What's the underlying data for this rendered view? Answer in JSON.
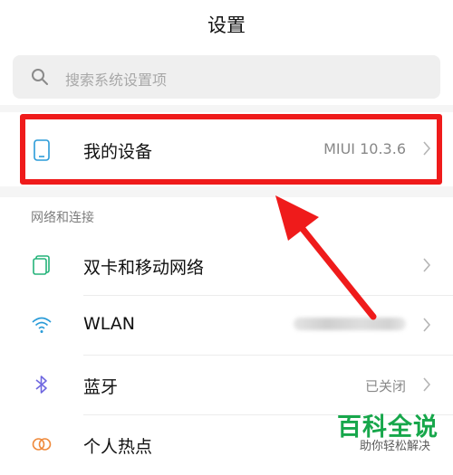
{
  "header": {
    "title": "设置"
  },
  "search": {
    "placeholder": "搜索系统设置项",
    "icon": "search-icon"
  },
  "device": {
    "label": "我的设备",
    "value": "MIUI 10.3.6",
    "icon": "phone-icon"
  },
  "section": {
    "label": "网络和连接"
  },
  "items": [
    {
      "label": "双卡和移动网络",
      "icon": "dual-sim-icon",
      "value": ""
    },
    {
      "label": "WLAN",
      "icon": "wifi-icon",
      "value": ""
    },
    {
      "label": "蓝牙",
      "icon": "bluetooth-icon",
      "value": "已关闭"
    },
    {
      "label": "个人热点",
      "icon": "hotspot-icon",
      "value": ""
    }
  ],
  "watermark": {
    "title": "百科全说",
    "subtitle": "助你轻松解决"
  },
  "colors": {
    "highlight": "#ef1b1b",
    "accent": "#2a9bd8",
    "watermark": "#17a74b"
  }
}
